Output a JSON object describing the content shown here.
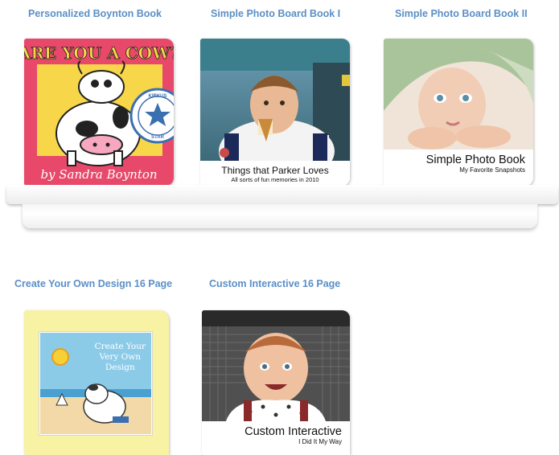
{
  "books": [
    {
      "title": "Personalized Boynton Book",
      "cover_title": "ARE YOU A COW?",
      "cover_author": "by Sandra Boynton",
      "badge_top": "KIRKUS",
      "badge_bottom": "STAR"
    },
    {
      "title": "Simple Photo Board Book I",
      "caption_main": "Things that Parker Loves",
      "caption_sub": "All sorts of fun memories in 2010"
    },
    {
      "title": "Simple Photo Board Book II",
      "caption_main": "Simple Photo Book",
      "caption_sub": "My Favorite Snapshots"
    },
    {
      "title": "Create Your Own Design 16 Page",
      "cover_text": [
        "Create Your",
        "Very Own",
        "Design"
      ]
    },
    {
      "title": "Custom Interactive 16 Page",
      "caption_main": "Custom Interactive",
      "caption_sub": "I Did It My Way"
    }
  ],
  "colors": {
    "title_link": "#5b8fc7",
    "boynton_pink": "#e8496a",
    "boynton_yellow": "#f7d64a",
    "design_yellow": "#f7f2a4"
  }
}
